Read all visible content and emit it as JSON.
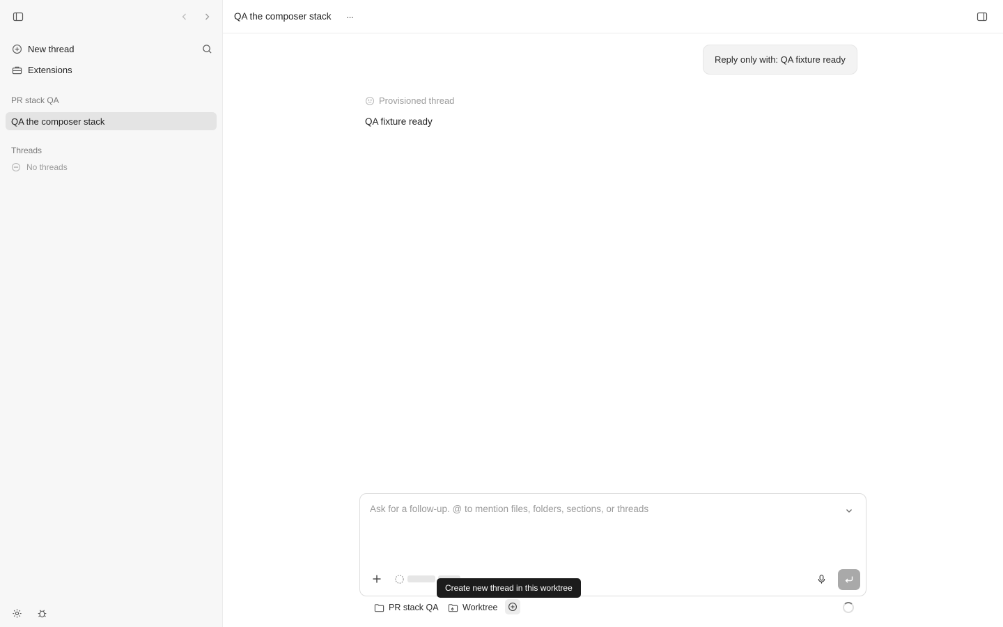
{
  "sidebar": {
    "new_thread_label": "New thread",
    "extensions_label": "Extensions",
    "project_section": "PR stack QA",
    "active_thread": "QA the composer stack",
    "threads_section": "Threads",
    "threads_empty": "No threads"
  },
  "header": {
    "title": "QA the composer stack",
    "more_label": "···"
  },
  "conversation": {
    "user_message": "Reply only with: QA fixture ready",
    "status": "Provisioned thread",
    "assistant_reply": "QA fixture ready"
  },
  "composer": {
    "placeholder": "Ask for a follow-up. @ to mention files, folders, sections, or threads",
    "value": ""
  },
  "tooltip": {
    "text": "Create new thread in this worktree"
  },
  "footer": {
    "project_label": "PR stack QA",
    "worktree_label": "Worktree"
  },
  "colors": {
    "sidebar_bg": "#f7f7f7",
    "active_item_bg": "#e4e4e4",
    "send_button": "#a9a9a9",
    "tooltip_bg": "#1c1c1c"
  }
}
